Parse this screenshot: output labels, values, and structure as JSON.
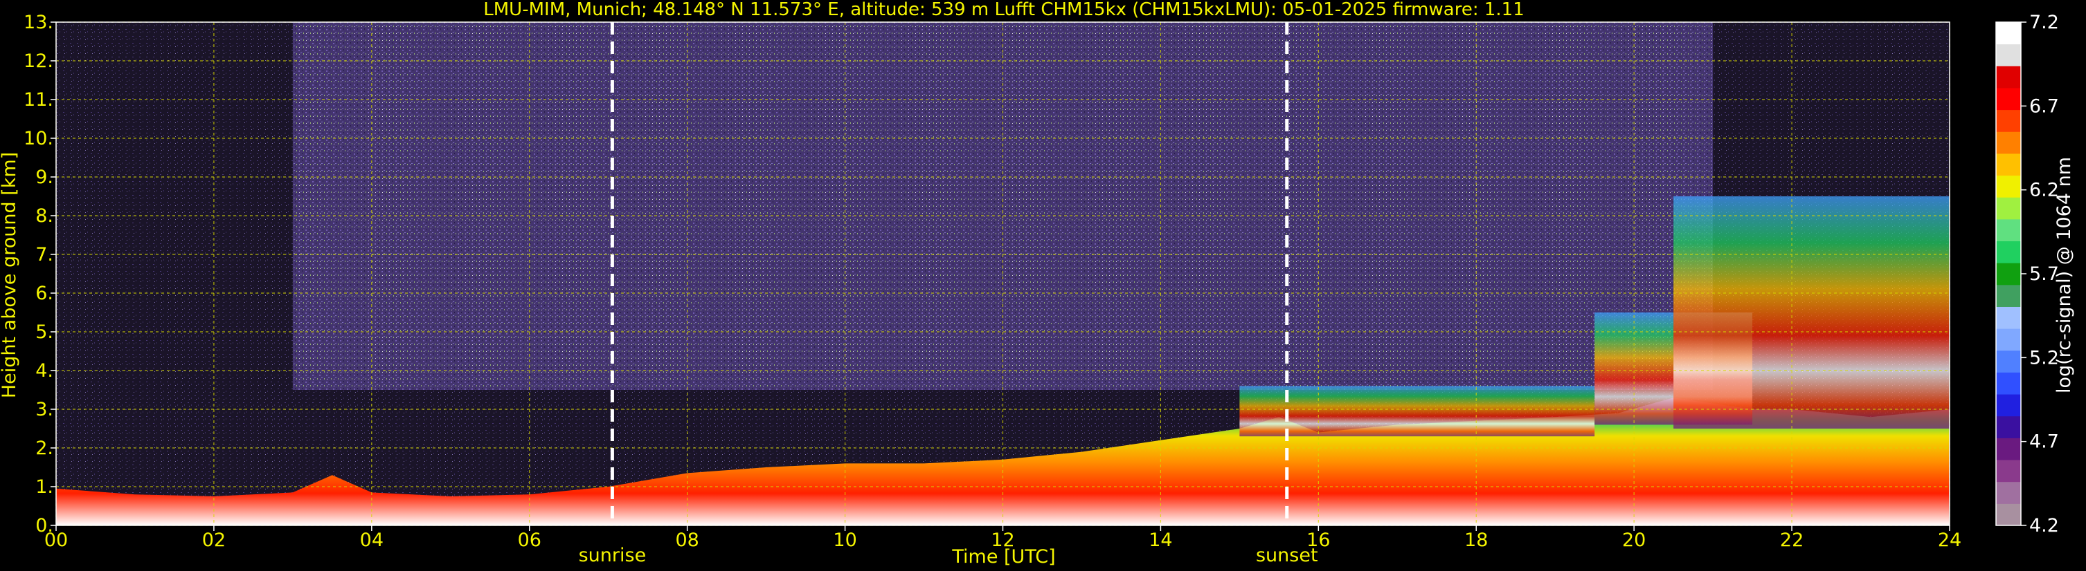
{
  "chart_data": {
    "type": "heatmap",
    "title": "LMU-MIM, Munich; 48.148° N 11.573° E, altitude: 539 m    Lufft CHM15kx (CHM15kxLMU): 05-01-2025    firmware: 1.11",
    "xlabel": "Time [UTC]",
    "ylabel": "Height above ground [km]",
    "colorbar_label": "log(rc-signal) @ 1064 nm",
    "xlim": [
      0,
      24
    ],
    "ylim": [
      0,
      13
    ],
    "x_ticks": [
      "00",
      "02",
      "04",
      "06",
      "08",
      "10",
      "12",
      "14",
      "16",
      "18",
      "20",
      "22",
      "24"
    ],
    "y_ticks": [
      "0.",
      "1.",
      "2.",
      "3.",
      "4.",
      "5.",
      "6.",
      "7.",
      "8.",
      "9.",
      "10.",
      "11.",
      "12.",
      "13."
    ],
    "colorbar_range": [
      4.2,
      7.2
    ],
    "colorbar_ticks": [
      "4.2",
      "4.7",
      "5.2",
      "5.7",
      "6.2",
      "6.7",
      "7.2"
    ],
    "grid": true,
    "grid_color": "#d8d800",
    "markers": [
      {
        "label": "sunrise",
        "x": 7.05
      },
      {
        "label": "sunset",
        "x": 15.6
      }
    ],
    "colormap": [
      "#a890a0",
      "#a070a0",
      "#8a3a8c",
      "#6a1a80",
      "#3a10a0",
      "#2020e0",
      "#3050ff",
      "#5080ff",
      "#80a8ff",
      "#a0c0ff",
      "#40a060",
      "#10a010",
      "#20d060",
      "#60e080",
      "#a0f040",
      "#f0f000",
      "#ffc000",
      "#ff8000",
      "#ff4000",
      "#ff0000",
      "#e00000",
      "#e0e0e0",
      "#ffffff"
    ],
    "boundary_layer_top_km": [
      [
        0,
        0.95
      ],
      [
        1,
        0.8
      ],
      [
        2,
        0.75
      ],
      [
        3,
        0.85
      ],
      [
        3.5,
        1.3
      ],
      [
        4,
        0.85
      ],
      [
        5,
        0.75
      ],
      [
        6,
        0.8
      ],
      [
        7,
        1.0
      ],
      [
        8,
        1.35
      ],
      [
        9,
        1.5
      ],
      [
        10,
        1.6
      ],
      [
        11,
        1.6
      ],
      [
        12,
        1.7
      ],
      [
        13,
        1.9
      ],
      [
        14,
        2.2
      ],
      [
        15,
        2.5
      ],
      [
        15.5,
        2.8
      ],
      [
        16,
        2.4
      ],
      [
        17,
        2.6
      ],
      [
        18,
        2.7
      ],
      [
        19,
        2.8
      ],
      [
        19.8,
        2.9
      ],
      [
        20.5,
        3.3
      ],
      [
        21.5,
        3.0
      ],
      [
        22,
        3.0
      ],
      [
        23,
        2.8
      ],
      [
        24,
        3.0
      ]
    ],
    "cloud_layers": [
      {
        "start": 15.0,
        "end": 19.5,
        "base_km": 2.3,
        "top_km": 3.6
      },
      {
        "start": 19.5,
        "end": 21.5,
        "base_km": 2.6,
        "top_km": 5.5
      },
      {
        "start": 20.5,
        "end": 24.0,
        "base_km": 2.5,
        "top_km": 8.5
      }
    ]
  }
}
